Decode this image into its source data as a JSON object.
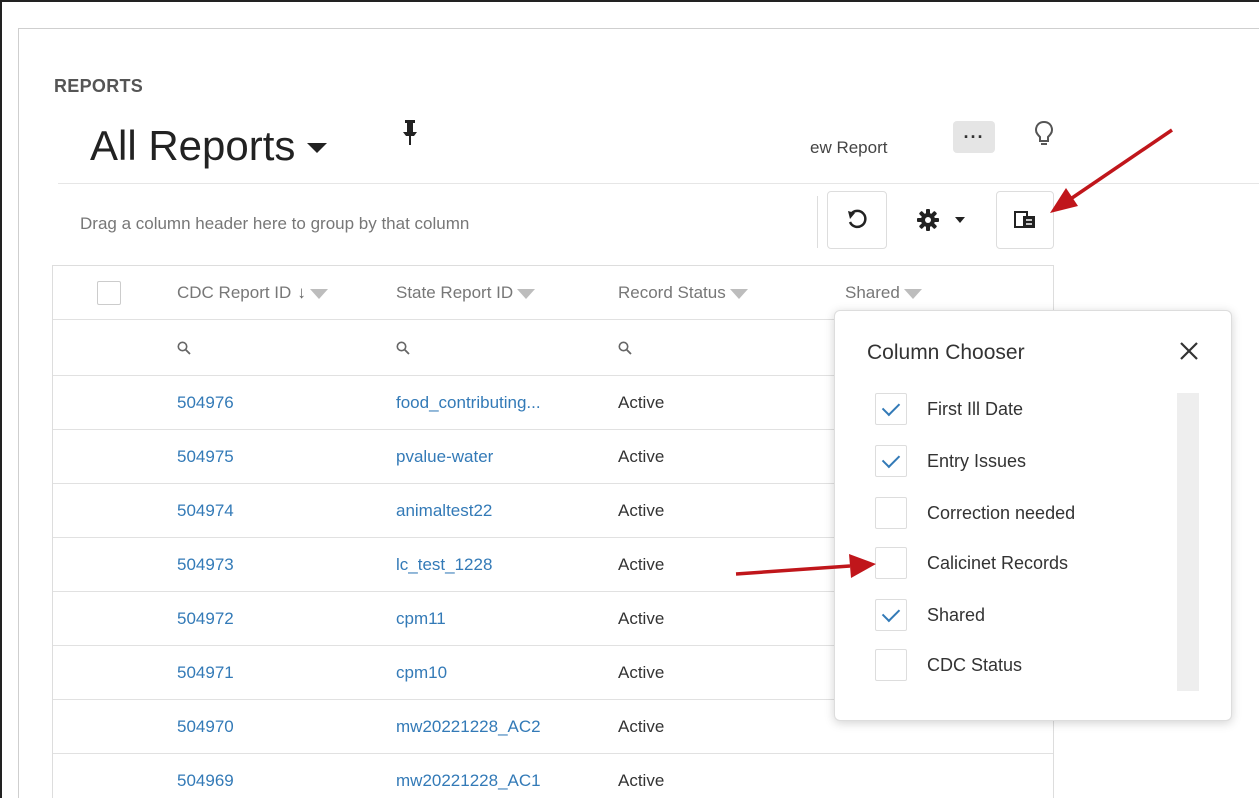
{
  "page": {
    "section_label": "REPORTS",
    "title": "All Reports",
    "new_report_label": "ew Report",
    "more_label": "···"
  },
  "toolbar": {
    "group_panel_text": "Drag a column header here to group by that column"
  },
  "grid": {
    "columns": [
      "CDC Report ID",
      "State Report ID",
      "Record Status",
      "Shared"
    ],
    "sort_indicator": "↓",
    "rows": [
      {
        "cdc_id": "504976",
        "state_id": "food_contributing...",
        "status": "Active"
      },
      {
        "cdc_id": "504975",
        "state_id": "pvalue-water",
        "status": "Active"
      },
      {
        "cdc_id": "504974",
        "state_id": "animaltest22",
        "status": "Active"
      },
      {
        "cdc_id": "504973",
        "state_id": "lc_test_1228",
        "status": "Active"
      },
      {
        "cdc_id": "504972",
        "state_id": "cpm11",
        "status": "Active"
      },
      {
        "cdc_id": "504971",
        "state_id": "cpm10",
        "status": "Active"
      },
      {
        "cdc_id": "504970",
        "state_id": "mw20221228_AC2",
        "status": "Active"
      },
      {
        "cdc_id": "504969",
        "state_id": "mw20221228_AC1",
        "status": "Active"
      }
    ]
  },
  "column_chooser": {
    "title": "Column Chooser",
    "items": [
      {
        "label": "First Ill Date",
        "checked": true
      },
      {
        "label": "Entry Issues",
        "checked": true
      },
      {
        "label": "Correction needed",
        "checked": false
      },
      {
        "label": "Calicinet Records",
        "checked": false
      },
      {
        "label": "Shared",
        "checked": true
      },
      {
        "label": "CDC Status",
        "checked": false
      }
    ]
  },
  "colors": {
    "link": "#337ab7",
    "annotation_arrow": "#c0161b",
    "more_button_bg": "#e5e5e5"
  }
}
